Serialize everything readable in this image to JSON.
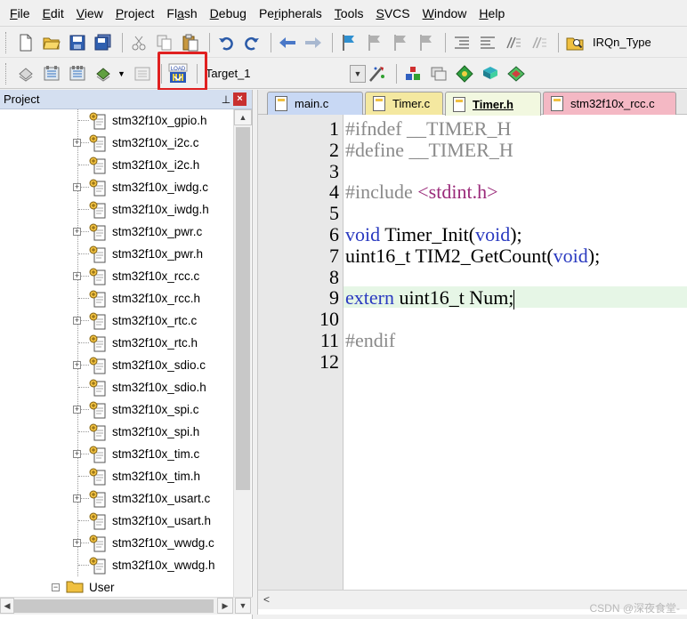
{
  "menubar": {
    "items": [
      {
        "label": "File",
        "u": "F"
      },
      {
        "label": "Edit",
        "u": "E"
      },
      {
        "label": "View",
        "u": "V"
      },
      {
        "label": "Project",
        "u": "P"
      },
      {
        "label": "Flash",
        "u": "a"
      },
      {
        "label": "Debug",
        "u": "D"
      },
      {
        "label": "Peripherals",
        "u": "r"
      },
      {
        "label": "Tools",
        "u": "T"
      },
      {
        "label": "SVCS",
        "u": "S"
      },
      {
        "label": "Window",
        "u": "W"
      },
      {
        "label": "Help",
        "u": "H"
      }
    ]
  },
  "toolbar1": {
    "find_combo": "IRQn_Type"
  },
  "toolbar2": {
    "load_icon_text": "LOAD",
    "target_value": "Target_1"
  },
  "project": {
    "title": "Project",
    "pin_icon": "pin-icon",
    "files": [
      {
        "name": "stm32f10x_gpio.h",
        "expandable": false
      },
      {
        "name": "stm32f10x_i2c.c",
        "expandable": true
      },
      {
        "name": "stm32f10x_i2c.h",
        "expandable": false
      },
      {
        "name": "stm32f10x_iwdg.c",
        "expandable": true
      },
      {
        "name": "stm32f10x_iwdg.h",
        "expandable": false
      },
      {
        "name": "stm32f10x_pwr.c",
        "expandable": true
      },
      {
        "name": "stm32f10x_pwr.h",
        "expandable": false
      },
      {
        "name": "stm32f10x_rcc.c",
        "expandable": true
      },
      {
        "name": "stm32f10x_rcc.h",
        "expandable": false
      },
      {
        "name": "stm32f10x_rtc.c",
        "expandable": true
      },
      {
        "name": "stm32f10x_rtc.h",
        "expandable": false
      },
      {
        "name": "stm32f10x_sdio.c",
        "expandable": true
      },
      {
        "name": "stm32f10x_sdio.h",
        "expandable": false
      },
      {
        "name": "stm32f10x_spi.c",
        "expandable": true
      },
      {
        "name": "stm32f10x_spi.h",
        "expandable": false
      },
      {
        "name": "stm32f10x_tim.c",
        "expandable": true
      },
      {
        "name": "stm32f10x_tim.h",
        "expandable": false
      },
      {
        "name": "stm32f10x_usart.c",
        "expandable": true
      },
      {
        "name": "stm32f10x_usart.h",
        "expandable": false
      },
      {
        "name": "stm32f10x_wwdg.c",
        "expandable": true
      },
      {
        "name": "stm32f10x_wwdg.h",
        "expandable": false
      }
    ],
    "group": "User"
  },
  "editor": {
    "tabs": [
      {
        "label": "main.c",
        "active": false,
        "color": "#c8d8f4"
      },
      {
        "label": "Timer.c",
        "active": false,
        "color": "#f4e8a0"
      },
      {
        "label": "Timer.h",
        "active": true,
        "color": "#e8f0c8"
      },
      {
        "label": "stm32f10x_rcc.c",
        "active": false,
        "color": "#f4b8c4"
      }
    ],
    "lines": [
      {
        "n": "1",
        "segs": [
          {
            "t": "#ifndef __TIMER_H",
            "c": "pp"
          }
        ]
      },
      {
        "n": "2",
        "segs": [
          {
            "t": "#define __TIMER_H",
            "c": "pp"
          }
        ]
      },
      {
        "n": "3",
        "segs": []
      },
      {
        "n": "4",
        "segs": [
          {
            "t": "#include ",
            "c": "pp"
          },
          {
            "t": "<stdint.h>",
            "c": "inc"
          }
        ]
      },
      {
        "n": "5",
        "segs": []
      },
      {
        "n": "6",
        "segs": [
          {
            "t": "void",
            "c": "kw"
          },
          {
            "t": " Timer_Init(",
            "c": ""
          },
          {
            "t": "void",
            "c": "kw"
          },
          {
            "t": ");",
            "c": ""
          }
        ]
      },
      {
        "n": "7",
        "segs": [
          {
            "t": "uint16_t TIM2_GetCount(",
            "c": ""
          },
          {
            "t": "void",
            "c": "kw"
          },
          {
            "t": ");",
            "c": ""
          }
        ]
      },
      {
        "n": "8",
        "segs": []
      },
      {
        "n": "9",
        "segs": [
          {
            "t": "extern",
            "c": "kw"
          },
          {
            "t": " uint16_t Num;",
            "c": ""
          }
        ],
        "current": true
      },
      {
        "n": "10",
        "segs": []
      },
      {
        "n": "11",
        "segs": [
          {
            "t": "#endif",
            "c": "pp"
          }
        ]
      },
      {
        "n": "12",
        "segs": []
      }
    ]
  },
  "watermark": "CSDN @深夜食堂-",
  "colors": {
    "highlight": "#e02020",
    "keyword": "#2a3ac0",
    "preprocessor": "#8a8a8a",
    "include": "#9a2a7a",
    "current_line": "#e6f6e6"
  }
}
